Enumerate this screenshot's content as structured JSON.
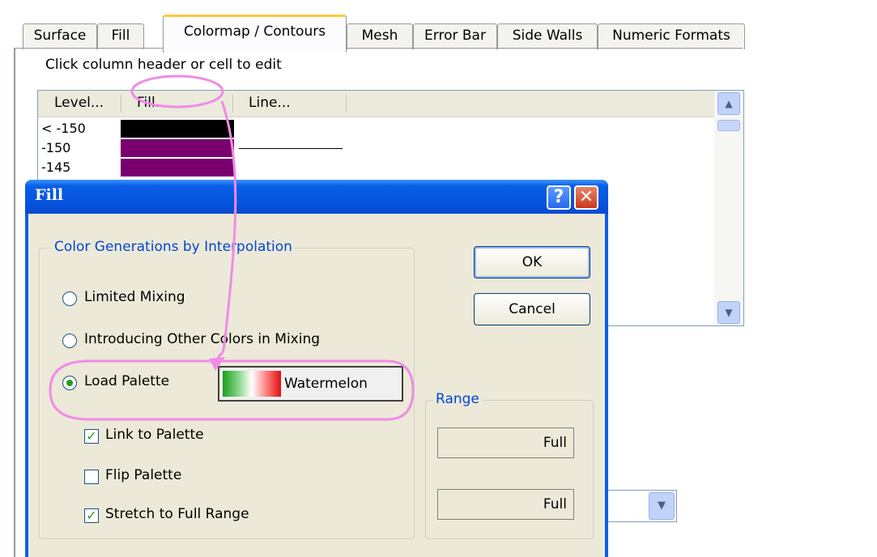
{
  "tabs": [
    {
      "label": "Surface"
    },
    {
      "label": "Fill"
    },
    {
      "label": "Colormap / Contours",
      "active": true
    },
    {
      "label": "Mesh"
    },
    {
      "label": "Error Bar"
    },
    {
      "label": "Side Walls"
    },
    {
      "label": "Numeric Formats"
    }
  ],
  "hint": "Click column header or cell to edit",
  "table": {
    "columns": [
      "Level...",
      "Fill...",
      "Line..."
    ],
    "rows": [
      {
        "level": "< -150",
        "fill": "#000000",
        "line": false
      },
      {
        "level": "-150",
        "fill": "#7a006f",
        "line": true
      },
      {
        "level": "-145",
        "fill": "#7a006f",
        "line": false
      }
    ],
    "scroll_up_icon": "chevron-up-icon",
    "scroll_down_icon": "chevron-down-icon"
  },
  "dialog": {
    "title": "Fill",
    "help_label": "?",
    "close_label": "✕",
    "group_title": "Color Generations by Interpolation",
    "options": {
      "limited": "Limited Mixing",
      "other": "Introducing Other Colors in Mixing",
      "load": "Load Palette"
    },
    "selected_option": "Load Palette",
    "palette_name": "Watermelon",
    "palette_colors": [
      "#1aa01a",
      "#ffffff",
      "#e01010"
    ],
    "checkboxes": {
      "link": {
        "label": "Link to Palette",
        "checked": true
      },
      "flip": {
        "label": "Flip Palette",
        "checked": false
      },
      "stretch": {
        "label": "Stretch to Full Range",
        "checked": true
      }
    },
    "ok_label": "OK",
    "cancel_label": "Cancel",
    "range_title": "Range",
    "range_values": [
      "Full",
      "Full"
    ]
  },
  "colors": {
    "accent": "#0046d5",
    "annotation": "#f08ce6",
    "tab_highlight": "#ffc83c"
  }
}
